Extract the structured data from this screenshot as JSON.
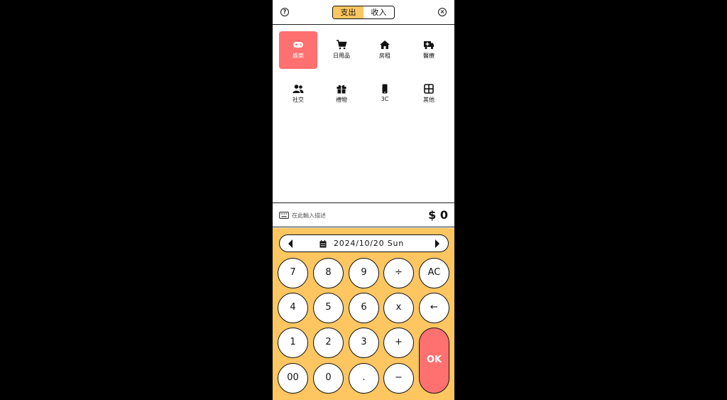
{
  "header": {
    "help_icon": "question-circle-icon",
    "close_icon": "close-circle-icon",
    "tabs": [
      {
        "label": "支出",
        "active": true
      },
      {
        "label": "收入",
        "active": false
      }
    ]
  },
  "categories": [
    {
      "label": "娛樂",
      "icon": "gamepad-icon",
      "selected": true
    },
    {
      "label": "日用品",
      "icon": "cart-icon",
      "selected": false
    },
    {
      "label": "房租",
      "icon": "home-icon",
      "selected": false
    },
    {
      "label": "醫療",
      "icon": "ambulance-icon",
      "selected": false
    },
    {
      "label": "社交",
      "icon": "users-icon",
      "selected": false
    },
    {
      "label": "禮物",
      "icon": "gift-icon",
      "selected": false
    },
    {
      "label": "3C",
      "icon": "phone-icon",
      "selected": false
    },
    {
      "label": "其他",
      "icon": "grid-icon",
      "selected": false
    }
  ],
  "description": {
    "placeholder": "在此輸入描述",
    "icon": "keyboard-icon"
  },
  "amount": "$ 0",
  "date": {
    "text": "2024/10/20 Sun",
    "icon": "calendar-icon"
  },
  "keypad": {
    "keys": [
      "7",
      "8",
      "9",
      "÷",
      "AC",
      "4",
      "5",
      "6",
      "x",
      "←",
      "1",
      "2",
      "3",
      "+",
      "00",
      "0",
      ".",
      "−"
    ],
    "ok": "OK"
  },
  "colors": {
    "accent": "#fdc660",
    "selected": "#ff7070",
    "background": "#000000"
  }
}
